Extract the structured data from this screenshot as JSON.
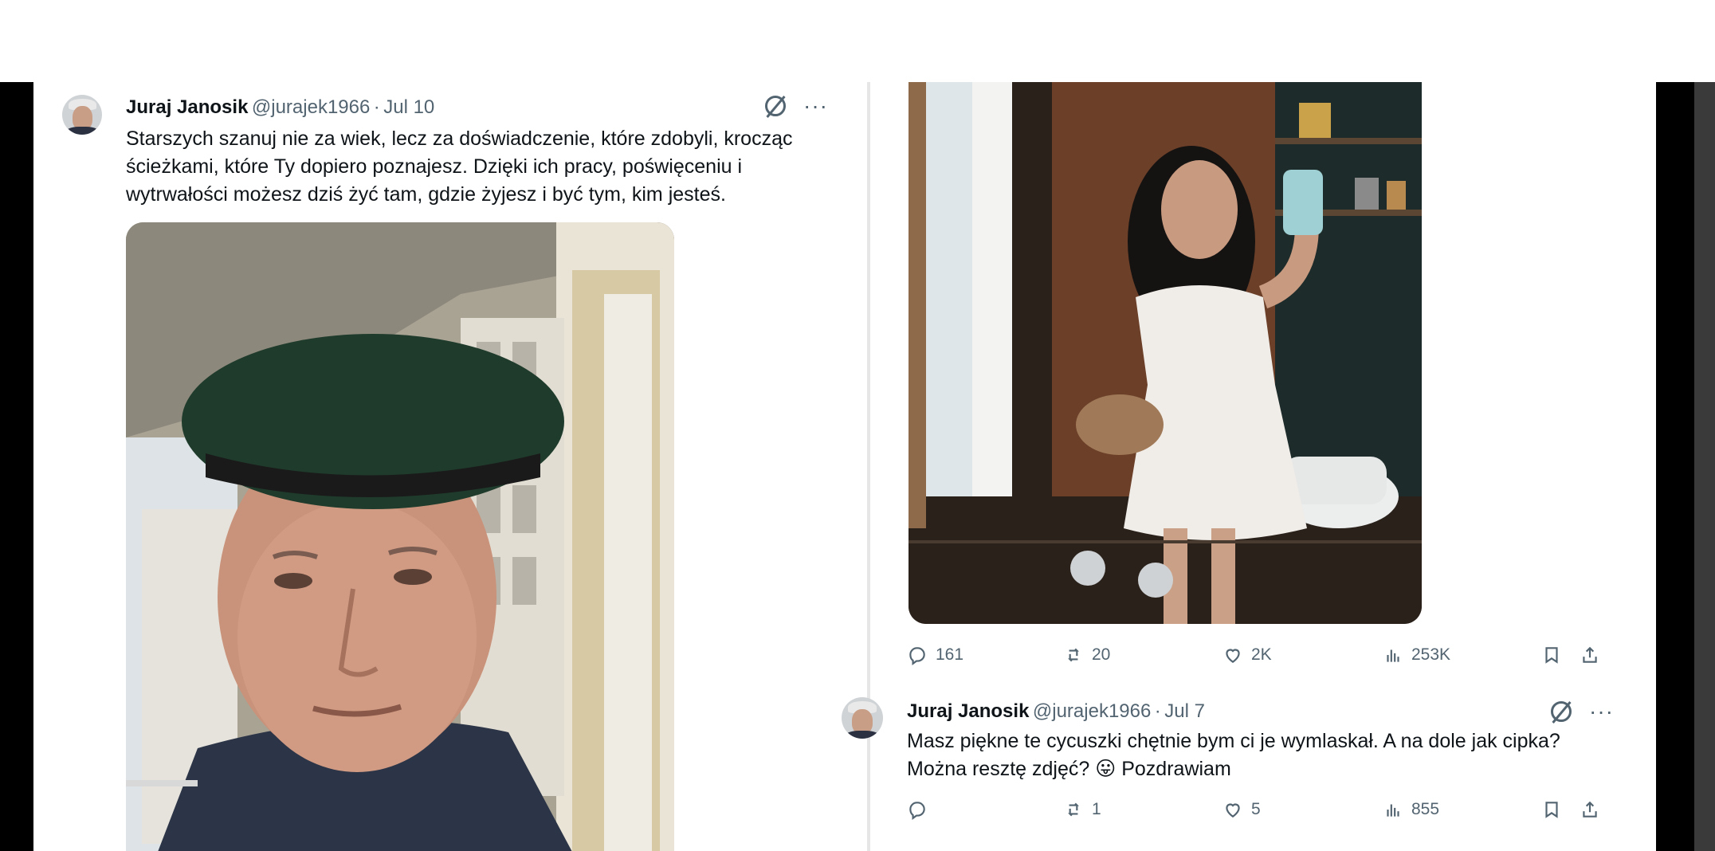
{
  "left_tweet": {
    "author_name": "Juraj Janosik",
    "handle": "@jurajek1966",
    "date": "Jul 10",
    "separator": "·",
    "text_lines": [
      "Starszych szanuj nie za wiek, lecz za doświadczenie, które zdobyli, krocząc",
      "ścieżkami, które Ty dopiero poznajesz. Dzięki ich pracy, poświęceniu i",
      "wytrwałości możesz dziś żyć tam, gdzie żyjesz i być tym, kim jesteś."
    ],
    "icons": [
      "grok-icon",
      "more-icon"
    ],
    "more_glyph": "···"
  },
  "right_top_actions": {
    "replies": "161",
    "reposts": "20",
    "likes": "2K",
    "views": "253K"
  },
  "right_reply": {
    "author_name": "Juraj Janosik",
    "handle": "@jurajek1966",
    "date": "Jul 7",
    "separator": "·",
    "text_lines": [
      "Masz piękne te cycuszki chętnie bym ci je wymlaskał. A na dole jak cipka?",
      "Można resztę zdjęć? 😛 Pozdrawiam"
    ],
    "more_glyph": "···",
    "actions": {
      "replies": "",
      "reposts": "1",
      "likes": "5",
      "views": "855"
    }
  },
  "colors": {
    "text": "#0f1419",
    "secondary": "#536471",
    "frame": "#000000"
  }
}
